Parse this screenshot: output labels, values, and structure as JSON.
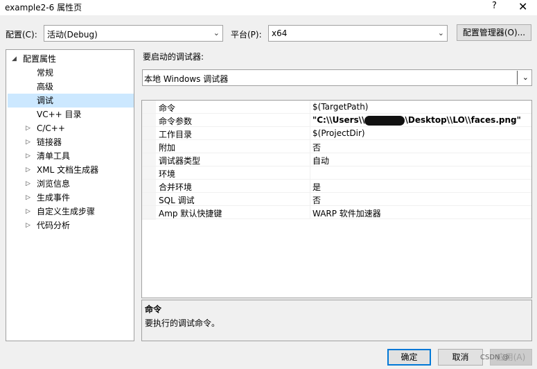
{
  "window": {
    "title": "example2-6 属性页",
    "help": "?",
    "close": "✕"
  },
  "config": {
    "label": "配置(C):",
    "value": "活动(Debug)"
  },
  "platform": {
    "label": "平台(P):",
    "value": "x64"
  },
  "config_manager_button": "配置管理器(O)...",
  "tree": {
    "root": "配置属性",
    "items": [
      {
        "label": "常规",
        "expandable": false,
        "selected": false
      },
      {
        "label": "高级",
        "expandable": false,
        "selected": false
      },
      {
        "label": "调试",
        "expandable": false,
        "selected": true
      },
      {
        "label": "VC++ 目录",
        "expandable": false,
        "selected": false
      },
      {
        "label": "C/C++",
        "expandable": true,
        "selected": false
      },
      {
        "label": "链接器",
        "expandable": true,
        "selected": false
      },
      {
        "label": "清单工具",
        "expandable": true,
        "selected": false
      },
      {
        "label": "XML 文档生成器",
        "expandable": true,
        "selected": false
      },
      {
        "label": "浏览信息",
        "expandable": true,
        "selected": false
      },
      {
        "label": "生成事件",
        "expandable": true,
        "selected": false
      },
      {
        "label": "自定义生成步骤",
        "expandable": true,
        "selected": false
      },
      {
        "label": "代码分析",
        "expandable": true,
        "selected": false
      }
    ]
  },
  "debugger": {
    "label": "要启动的调试器:",
    "value": "本地 Windows 调试器"
  },
  "properties": [
    {
      "name": "命令",
      "value": "$(TargetPath)",
      "bold": false
    },
    {
      "name": "命令参数",
      "value_prefix": "\"C:\\\\Users\\\\",
      "value_suffix": "\\Desktop\\\\LO\\\\faces.png\"",
      "bold": true
    },
    {
      "name": "工作目录",
      "value": "$(ProjectDir)",
      "bold": false
    },
    {
      "name": "附加",
      "value": "否",
      "bold": false
    },
    {
      "name": "调试器类型",
      "value": "自动",
      "bold": false
    },
    {
      "name": "环境",
      "value": "",
      "bold": false
    },
    {
      "name": "合并环境",
      "value": "是",
      "bold": false
    },
    {
      "name": "SQL 调试",
      "value": "否",
      "bold": false
    },
    {
      "name": "Amp 默认快捷键",
      "value": "WARP 软件加速器",
      "bold": false
    }
  ],
  "description": {
    "title": "命令",
    "text": "要执行的调试命令。"
  },
  "buttons": {
    "ok": "确定",
    "cancel": "取消",
    "apply": "应用(A)"
  },
  "watermark": "CSDN @"
}
